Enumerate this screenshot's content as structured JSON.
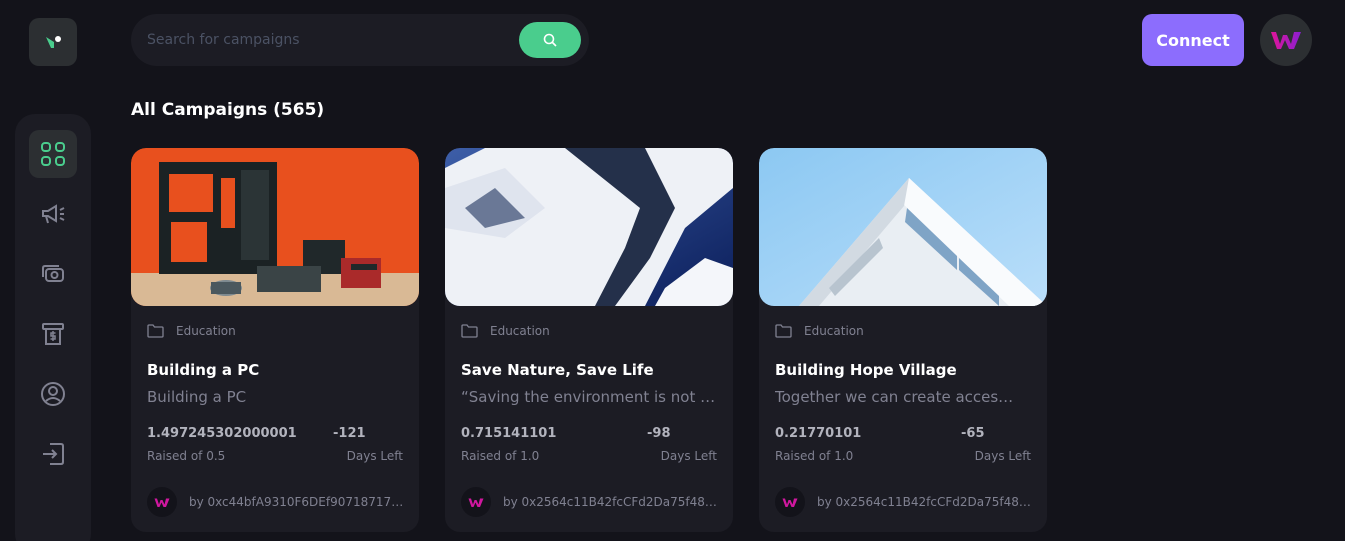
{
  "search": {
    "placeholder": "Search for campaigns"
  },
  "header": {
    "connect_label": "Connect"
  },
  "main": {
    "title": "All Campaigns (565)"
  },
  "colors": {
    "accent_green": "#4acd8d",
    "accent_purple": "#8c6dfd",
    "background": "#13131a",
    "card": "#1c1c24"
  },
  "sidebar": {
    "items": [
      {
        "icon": "dashboard-icon",
        "active": true
      },
      {
        "icon": "megaphone-icon",
        "active": false
      },
      {
        "icon": "payment-icon",
        "active": false
      },
      {
        "icon": "withdraw-icon",
        "active": false
      },
      {
        "icon": "profile-icon",
        "active": false
      },
      {
        "icon": "logout-icon",
        "active": false
      }
    ]
  },
  "campaigns": [
    {
      "image": "pc-parts-photo",
      "category": "Education",
      "title": "Building a PC",
      "description": "Building a PC",
      "amount": "1.497245302000001",
      "raised_of": "Raised of 0.5",
      "days": "-121",
      "days_label": "Days Left",
      "owner": "by 0xc44bfA9310F6DEf90718717cda2..."
    },
    {
      "image": "snowy-mountain-photo",
      "category": "Education",
      "title": "Save Nature, Save Life",
      "description": "“Saving the environment is not …",
      "amount": "0.715141101",
      "raised_of": "Raised of 1.0",
      "days": "-98",
      "days_label": "Days Left",
      "owner": "by 0x2564c11B42fcCFd2Da75f48222..."
    },
    {
      "image": "white-building-photo",
      "category": "Education",
      "title": "Building Hope Village",
      "description": "Together we can create acces…",
      "amount": "0.21770101",
      "raised_of": "Raised of 1.0",
      "days": "-65",
      "days_label": "Days Left",
      "owner": "by 0x2564c11B42fcCFd2Da75f48222..."
    }
  ]
}
